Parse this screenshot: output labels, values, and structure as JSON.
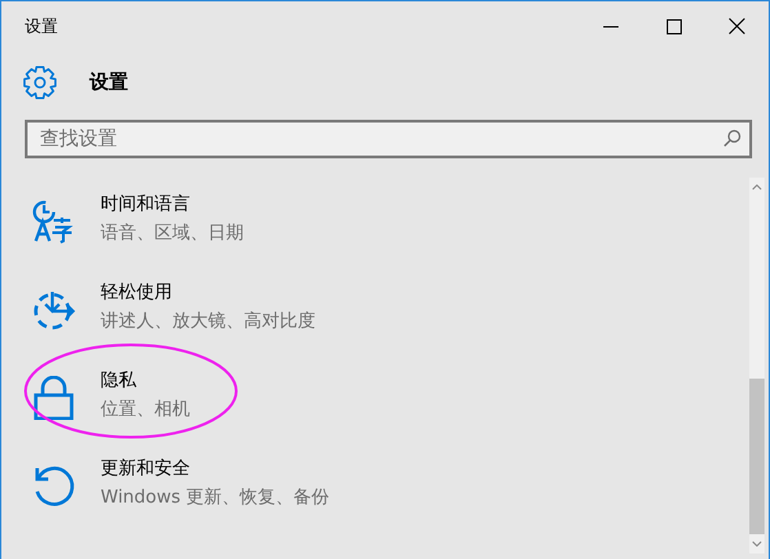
{
  "window": {
    "title": "设置",
    "controls": [
      {
        "kind": "minimize"
      },
      {
        "kind": "maximize"
      },
      {
        "kind": "close"
      }
    ]
  },
  "header": {
    "title": "设置"
  },
  "search": {
    "placeholder": "查找设置"
  },
  "items": [
    {
      "kind": "time-language",
      "title": "时间和语言",
      "subtitle": "语音、区域、日期",
      "highlighted": false
    },
    {
      "kind": "ease",
      "title": "轻松使用",
      "subtitle": "讲述人、放大镜、高对比度",
      "highlighted": false
    },
    {
      "kind": "privacy",
      "title": "隐私",
      "subtitle": "位置、相机",
      "highlighted": true
    },
    {
      "kind": "update",
      "title": "更新和安全",
      "subtitle": "Windows 更新、恢复、备份",
      "highlighted": false
    }
  ]
}
